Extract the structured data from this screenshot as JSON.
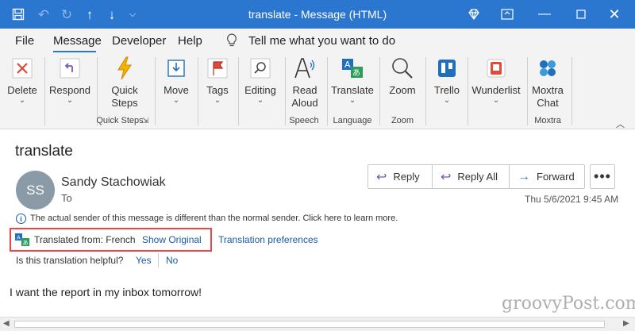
{
  "window": {
    "title": "translate  -  Message (HTML)"
  },
  "menu": {
    "tabs": [
      "File",
      "Message",
      "Developer",
      "Help"
    ],
    "active_tab": "Message",
    "tell_me": "Tell me what you want to do"
  },
  "ribbon": {
    "buttons": [
      {
        "label": "Delete",
        "icon": "delete-x-icon"
      },
      {
        "label": "Respond",
        "icon": "respond-arrow-icon"
      },
      {
        "label": "Quick\nSteps",
        "icon": "lightning-icon"
      },
      {
        "label": "Move",
        "icon": "move-icon"
      },
      {
        "label": "Tags",
        "icon": "flag-icon"
      },
      {
        "label": "Editing",
        "icon": "search-icon"
      },
      {
        "label": "Read\nAloud",
        "icon": "read-aloud-icon"
      },
      {
        "label": "Translate",
        "icon": "translate-icon"
      },
      {
        "label": "Zoom",
        "icon": "magnifier-icon"
      },
      {
        "label": "Trello",
        "icon": "trello-icon"
      },
      {
        "label": "Wunderlist",
        "icon": "wunderlist-icon"
      },
      {
        "label": "Moxtra\nChat",
        "icon": "moxtra-icon"
      }
    ],
    "groups": [
      "Quick Steps",
      "Speech",
      "Language",
      "Zoom",
      "Moxtra"
    ],
    "colors": {
      "accent": "#2b76cf",
      "delete": "#e04a3a",
      "respond": "#7a57b4",
      "quick_steps": "#f0a500",
      "trello": "#1f6fbf",
      "wunderlist": "#e04a3a"
    }
  },
  "message": {
    "subject": "translate",
    "avatar_initials": "SS",
    "sender": "Sandy Stachowiak",
    "to_label": "To",
    "actions": {
      "reply": "Reply",
      "reply_all": "Reply All",
      "forward": "Forward",
      "more": "•••"
    },
    "datetime": "Thu 5/6/2021 9:45 AM",
    "info_notice": "The actual sender of this message is different than the normal sender. Click here to learn more.",
    "translation": {
      "translated_from": "Translated from: French",
      "show_original": "Show Original",
      "preferences": "Translation preferences",
      "helpful_question": "Is this translation helpful?",
      "yes": "Yes",
      "no": "No"
    },
    "body": "I want the report in my inbox tomorrow!"
  },
  "watermark": "groovyPost.com"
}
